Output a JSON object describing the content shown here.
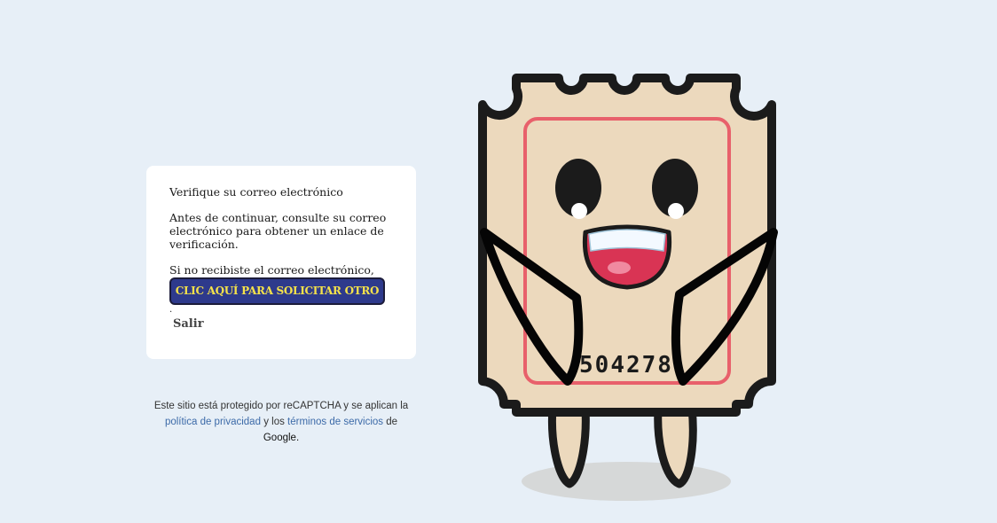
{
  "verify": {
    "title": "Verifique su correo electrónico",
    "body": "Antes de continuar, consulte su correo electrónico para obtener un enlace de verificación.",
    "no_mail": "Si no recibiste el correo electrónico,",
    "resend_label": "CLIC AQUÍ PARA SOLICITAR OTRO",
    "dot": ".",
    "logout_label": "Salir"
  },
  "recaptcha": {
    "prefix": "Este sitio está protegido por reCAPTCHA y se aplican la",
    "privacy_link": "política de privacidad",
    "and": "y los",
    "terms_link": "términos de servicios",
    "of": "de",
    "google": "Google."
  },
  "mascot": {
    "ticket_number": "504278"
  },
  "colors": {
    "background": "#e7eff7",
    "button_bg": "#2e3a8c",
    "button_text": "#f5e24a",
    "link": "#3c6aa8",
    "ticket_fill": "#ecd9bd",
    "ticket_inner_border": "#e8606b"
  }
}
